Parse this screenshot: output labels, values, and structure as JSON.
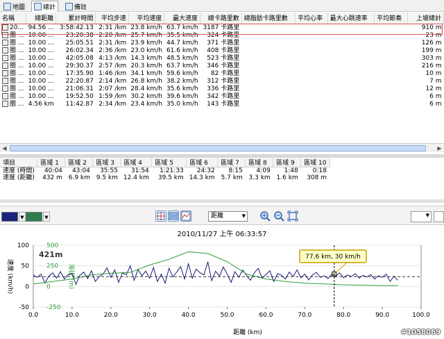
{
  "tabs": [
    {
      "label": "地圖"
    },
    {
      "label": "總計"
    },
    {
      "label": "備註"
    }
  ],
  "table": {
    "columns": [
      "名稱",
      "總距離",
      "累計時間",
      "平均步速",
      "平均速度",
      "最大速度",
      "總卡路里數",
      "總脂肪卡路里數",
      "平均心率",
      "最大心跳速率",
      "平均節奏",
      "上坡總計"
    ],
    "rows": [
      [
        "20...",
        "94.56 ...",
        "3:58:42.13",
        "2:31 /km",
        "23.8 km/h",
        "63.7 km/h",
        "3187 卡路里",
        "",
        "",
        "",
        "",
        "910 m"
      ],
      [
        "圈 ...",
        "10.00 ...",
        "23:20.38",
        "2:20 /km",
        "25.7 km/h",
        "35.5 km/h",
        "324 卡路里",
        "",
        "",
        "",
        "",
        "23 m"
      ],
      [
        "圈 ...",
        "10.00 ...",
        "25:05.51",
        "2:31 /km",
        "23.9 km/h",
        "44.7 km/h",
        "371 卡路里",
        "",
        "",
        "",
        "",
        "126 m"
      ],
      [
        "圈 ...",
        "10.00 ...",
        "26:02.34",
        "2:36 /km",
        "23.0 km/h",
        "61.6 km/h",
        "408 卡路里",
        "",
        "",
        "",
        "",
        "199 m"
      ],
      [
        "圈 ...",
        "10.00 ...",
        "42:05.08",
        "4:13 /km",
        "14.3 km/h",
        "48.5 km/h",
        "523 卡路里",
        "",
        "",
        "",
        "",
        "303 m"
      ],
      [
        "圈 ...",
        "10.00 ...",
        "29:30.37",
        "2:57 /km",
        "20.3 km/h",
        "63.7 km/h",
        "346 卡路里",
        "",
        "",
        "",
        "",
        "216 m"
      ],
      [
        "圈 ...",
        "10.00 ...",
        "17:35.90",
        "1:46 /km",
        "34.1 km/h",
        "59.6 km/h",
        "82 卡路里",
        "",
        "",
        "",
        "",
        "10 m"
      ],
      [
        "圈 ...",
        "10.00 ...",
        "22:20.87",
        "2:14 /km",
        "26.8 km/h",
        "38.2 km/h",
        "312 卡路里",
        "",
        "",
        "",
        "",
        "7 m"
      ],
      [
        "圈 ...",
        "10.00 ...",
        "21:06.31",
        "2:07 /km",
        "28.4 km/h",
        "35.6 km/h",
        "336 卡路里",
        "",
        "",
        "",
        "",
        "12 m"
      ],
      [
        "圈 ...",
        "10.00 ...",
        "19:52.50",
        "1:59 /km",
        "30.2 km/h",
        "39.6 km/h",
        "342 卡路里",
        "",
        "",
        "",
        "",
        "6 m"
      ],
      [
        "圈 ...",
        "4.56 km",
        "11:42.87",
        "2:34 /km",
        "23.4 km/h",
        "35.0 km/h",
        "143 卡路里",
        "",
        "",
        "",
        "",
        "6 m"
      ]
    ]
  },
  "zones": {
    "columns": [
      "項目",
      "區域 1",
      "區域 2",
      "區域 3",
      "區域 4",
      "區域 5",
      "區域 6",
      "區域 7",
      "區域 8",
      "區域 9",
      "區域 10"
    ],
    "rows": [
      [
        "速度 (時間)",
        "40:04",
        "43:04",
        "35:55",
        "31:54",
        "1:21:33",
        "24:32",
        "8:15",
        "4:09",
        "1:48",
        "0:18"
      ],
      [
        "速度 (距離)",
        "432 m",
        "6.9 km",
        "9.5 km",
        "12.4 km",
        "39.5 km",
        "14.3 km",
        "5.7 km",
        "3.3 km",
        "1.6 km",
        "308 m"
      ]
    ]
  },
  "toolbar": {
    "metric_value": "距離",
    "color1": "#1a237e",
    "color2": "#2e7d4f"
  },
  "chart": {
    "timestamp": "2010/11/27 上午 06:33:57",
    "cursor_label": "77.6 km, 30 km/h",
    "elev_badge": "421m",
    "ylabel_left": "速度 (km/h)",
    "ylabel_right": "海拔 (m)",
    "xlabel": "距離 (km)",
    "watermark": "#1058069"
  },
  "chart_data": {
    "type": "line",
    "xlabel": "距離 (km)",
    "ylabel": "速度 (km/h)",
    "xlim": [
      0,
      100
    ],
    "ylim": [
      -50,
      100
    ],
    "y2lim": [
      -250,
      500
    ],
    "x_ticks": [
      "0.0",
      "10.0",
      "20.0",
      "30.0",
      "40.0",
      "50.0",
      "60.0",
      "70.0",
      "80.0",
      "90.0",
      "100.0"
    ],
    "y_ticks": [
      "100",
      "50",
      "0",
      "-50"
    ],
    "y2_ticks": [
      "500",
      "250",
      "0",
      "-250"
    ],
    "avg_speed": 23.8,
    "cursor_x": 77.6,
    "cursor_y": 30,
    "series": [
      {
        "name": "速度",
        "color": "#1a1a7a",
        "x": [
          0,
          1,
          2,
          3,
          4,
          5,
          6,
          7,
          8,
          9,
          10,
          11,
          12,
          13,
          14,
          15,
          16,
          17,
          18,
          19,
          20,
          21,
          22,
          23,
          24,
          25,
          26,
          27,
          28,
          29,
          30,
          31,
          32,
          33,
          34,
          35,
          36,
          37,
          38,
          39,
          40,
          41,
          42,
          43,
          44,
          45,
          46,
          47,
          48,
          49,
          50,
          51,
          52,
          53,
          54,
          55,
          56,
          57,
          58,
          59,
          60,
          61,
          62,
          63,
          64,
          65,
          66,
          67,
          68,
          69,
          70,
          71,
          72,
          73,
          74,
          75,
          76,
          77,
          78,
          79,
          80,
          81,
          82,
          83,
          84,
          85,
          86,
          87,
          88,
          89,
          90,
          91,
          92,
          93,
          94
        ],
        "values": [
          28,
          22,
          30,
          8,
          25,
          33,
          20,
          36,
          18,
          29,
          31,
          5,
          27,
          35,
          19,
          38,
          12,
          24,
          30,
          45,
          22,
          40,
          10,
          33,
          28,
          50,
          15,
          41,
          26,
          37,
          20,
          46,
          12,
          30,
          8,
          44,
          23,
          35,
          48,
          18,
          55,
          20,
          42,
          33,
          28,
          60,
          14,
          37,
          25,
          47,
          30,
          10,
          36,
          22,
          40,
          26,
          15,
          33,
          44,
          20,
          29,
          38,
          12,
          31,
          27,
          18,
          35,
          24,
          40,
          21,
          30,
          16,
          28,
          34,
          22,
          26,
          19,
          30,
          25,
          33,
          21,
          28,
          24,
          31,
          20,
          27,
          23,
          29,
          18,
          26,
          22,
          30,
          12,
          25,
          15
        ]
      },
      {
        "name": "海拔",
        "color": "#2e9e3a",
        "x": [
          0,
          5,
          10,
          15,
          20,
          25,
          30,
          35,
          40,
          45,
          50,
          55,
          60,
          65,
          70,
          75,
          80,
          85,
          90,
          94
        ],
        "values": [
          30,
          60,
          90,
          140,
          160,
          170,
          260,
          330,
          421,
          400,
          300,
          150,
          90,
          60,
          40,
          30,
          20,
          15,
          10,
          10
        ]
      }
    ]
  }
}
